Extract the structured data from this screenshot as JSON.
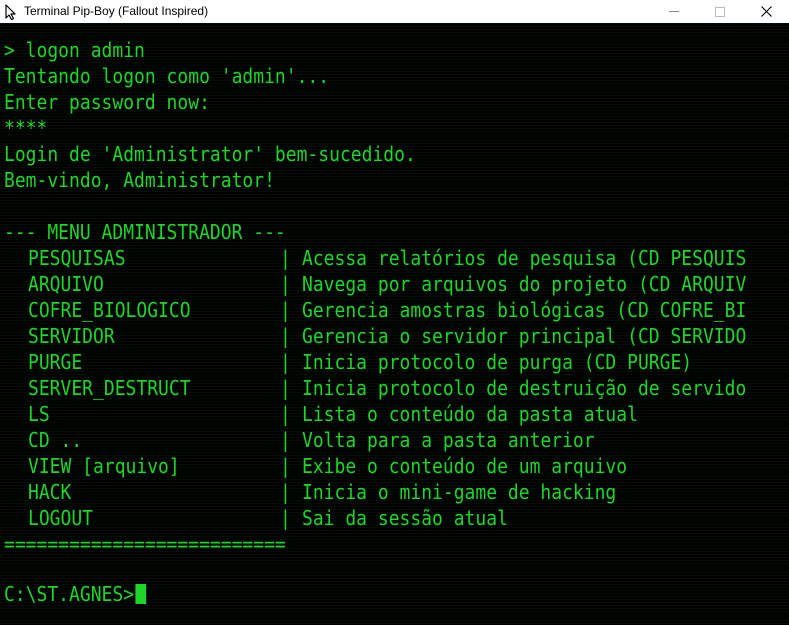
{
  "window": {
    "title": "Terminal Pip-Boy (Fallout Inspired)"
  },
  "colors": {
    "terminal_bg": "#000000",
    "terminal_text": "#1fd42a",
    "titlebar_bg": "#ffffff"
  },
  "icons": {
    "app": "pip-boy-app-icon",
    "minimize": "minimize-icon",
    "maximize": "maximize-icon",
    "close": "close-icon"
  },
  "terminal": {
    "lines": [
      "> logon admin",
      "Tentando logon como 'admin'...",
      "Enter password now:",
      "****",
      "Login de 'Administrator' bem-sucedido.",
      "Bem-vindo, Administrator!"
    ],
    "menu_header": "--- MENU ADMINISTRADOR ---",
    "menu_items": [
      {
        "cmd": "PESQUISAS",
        "desc": "Acessa relatórios de pesquisa (CD PESQUIS"
      },
      {
        "cmd": "ARQUIVO",
        "desc": "Navega por arquivos do projeto (CD ARQUIV"
      },
      {
        "cmd": "COFRE_BIOLOGICO",
        "desc": "Gerencia amostras biológicas (CD COFRE_BI"
      },
      {
        "cmd": "SERVIDOR",
        "desc": "Gerencia o servidor principal (CD SERVIDO"
      },
      {
        "cmd": "PURGE",
        "desc": "Inicia protocolo de purga (CD PURGE)"
      },
      {
        "cmd": "SERVER_DESTRUCT",
        "desc": "Inicia protocolo de destruição de servido"
      },
      {
        "cmd": "LS",
        "desc": "Lista o conteúdo da pasta atual"
      },
      {
        "cmd": "CD ..",
        "desc": "Volta para a pasta anterior"
      },
      {
        "cmd": "VIEW [arquivo]",
        "desc": "Exibe o conteúdo de um arquivo"
      },
      {
        "cmd": "HACK",
        "desc": "Inicia o mini-game de hacking"
      },
      {
        "cmd": "LOGOUT",
        "desc": "Sai da sessão atual"
      }
    ],
    "menu_pipe": "|",
    "menu_footer": "==========================",
    "prompt": "C:\\ST.AGNES>"
  }
}
